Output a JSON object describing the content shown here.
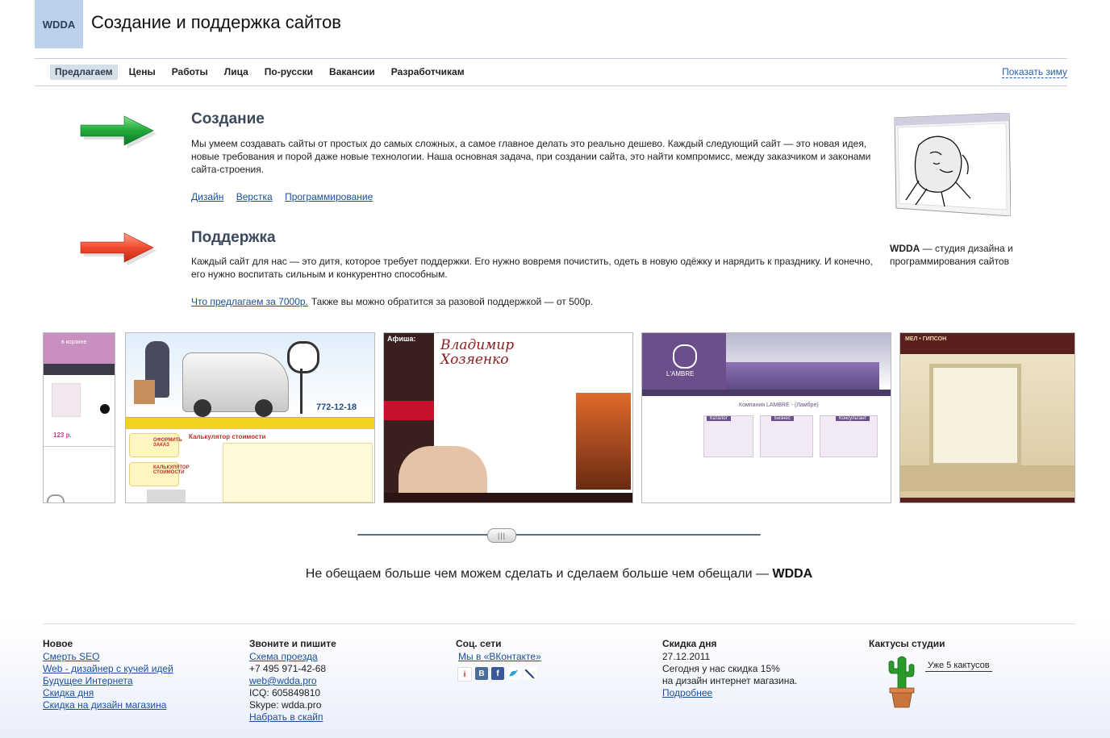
{
  "header": {
    "logo": "WDDA",
    "title": "Создание и поддержка сайтов"
  },
  "nav": {
    "items": [
      "Предлагаем",
      "Цены",
      "Работы",
      "Лица",
      "По-русски",
      "Вакансии",
      "Разработчикам"
    ],
    "active_index": 0,
    "show_winter": "Показать зиму"
  },
  "sections": {
    "creation": {
      "title": "Создание",
      "text": "Мы умеем создавать сайты от простых до самых сложных, а самое главное делать это реально дешево. Каждый следующий сайт — это новая идея, новые требования и порой даже новые технологии. Наша основная задача, при создании сайта, это найти компромисс, между заказчиком и законами сайта-строения.",
      "links": [
        "Дизайн",
        "Верстка",
        "Программирование"
      ]
    },
    "support": {
      "title": "Поддержка",
      "text": "Каждый сайт для нас — это дитя, которое требует поддержки. Его нужно вовремя почистить, одеть в новую одёжку и нарядить к празднику. И конечно, его нужно воспитать сильным и конкурентно способным.",
      "link": "Что предлагаем за 7000р.",
      "link_after": "Также вы можно обратится за разовой поддержкой — от 500р."
    }
  },
  "caption": {
    "brand": "WDDA",
    "text": "— студия дизайна и программирования сайтов"
  },
  "thumbnails": [
    {
      "label": "в корзине",
      "price": "123 р."
    },
    {
      "phone": "772-12-18",
      "calc": "Калькулятор стоимости",
      "order": "ОФОРМИТЬ ЗАКАЗ",
      "calc2": "КАЛЬКУЛЯТОР СТОИМОСТИ"
    },
    {
      "name": "Владимир Хозяенко",
      "tag": "Афиша:"
    },
    {
      "brand": "L'AMBRE",
      "title": "Компания LAMBRE - (Ламбре)",
      "tabs": [
        "Каталог",
        "Бизнес",
        "Консультант"
      ]
    },
    {
      "brand": "МЕЛ • ГИПСОН"
    }
  ],
  "slogan": {
    "text": "Не обещаем больше чем можем сделать и сделаем больше чем обещали — ",
    "brand": "WDDA"
  },
  "footer": {
    "news": {
      "title": "Новое",
      "links": [
        "Смерть SEO",
        "Web - дизайнер с кучей идей",
        "Будущее Интернета",
        "Скидка дня",
        "Скидка на дизайн магазина"
      ]
    },
    "contacts": {
      "title": "Звоните и пишите",
      "map": "Схема проезда",
      "phone": "+7 495 971-42-68",
      "email": "web@wdda.pro",
      "icq": "ICQ: 605849810",
      "skype": "Skype: wdda.pro",
      "skype_link": "Набрать в скайп"
    },
    "social": {
      "title": "Соц. сети",
      "vk": "Мы в «ВКонтакте»",
      "icons": [
        "moikrug-icon",
        "vkontakte-icon",
        "facebook-icon",
        "twitter-icon",
        "livejournal-icon"
      ]
    },
    "discount": {
      "title": "Скидка дня",
      "date": "27.12.2011",
      "line1": "Сегодня у нас скидка 15%",
      "line2": "на дизайн интернет магазина.",
      "more": "Подробнее"
    },
    "cactus": {
      "title": "Кактусы студии",
      "bubble": "Уже 5 кактусов"
    }
  }
}
